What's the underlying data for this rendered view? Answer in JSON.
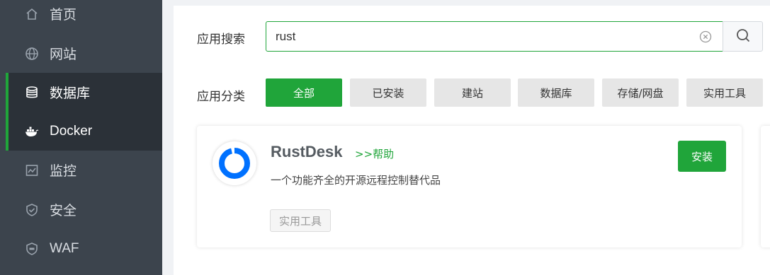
{
  "sidebar": {
    "items": [
      {
        "label": "首页",
        "icon": "home-icon",
        "active": false
      },
      {
        "label": "网站",
        "icon": "globe-icon",
        "active": false
      },
      {
        "label": "数据库",
        "icon": "database-icon",
        "active": true
      },
      {
        "label": "Docker",
        "icon": "docker-icon",
        "active": true
      },
      {
        "label": "监控",
        "icon": "monitor-icon",
        "active": false
      },
      {
        "label": "安全",
        "icon": "shield-icon",
        "active": false
      },
      {
        "label": "WAF",
        "icon": "waf-shield-icon",
        "active": false
      }
    ]
  },
  "search": {
    "label": "应用搜索",
    "value": "rust",
    "clear_icon": "clear-circle-icon",
    "search_icon": "search-icon"
  },
  "categories": {
    "label": "应用分类",
    "items": [
      {
        "label": "全部",
        "active": true
      },
      {
        "label": "已安装",
        "active": false
      },
      {
        "label": "建站",
        "active": false
      },
      {
        "label": "数据库",
        "active": false
      },
      {
        "label": "存储/网盘",
        "active": false
      },
      {
        "label": "实用工具",
        "active": false
      }
    ]
  },
  "app": {
    "name": "RustDesk",
    "help": ">>帮助",
    "description": "一个功能齐全的开源远程控制替代品",
    "tag": "实用工具",
    "install_label": "安装",
    "logo_icon": "rustdesk-logo-icon"
  },
  "colors": {
    "accent": "#20a53a",
    "sidebar_bg": "#3c444d",
    "sidebar_active_bg": "#2b3138",
    "logo_blue": "#0071ff"
  }
}
